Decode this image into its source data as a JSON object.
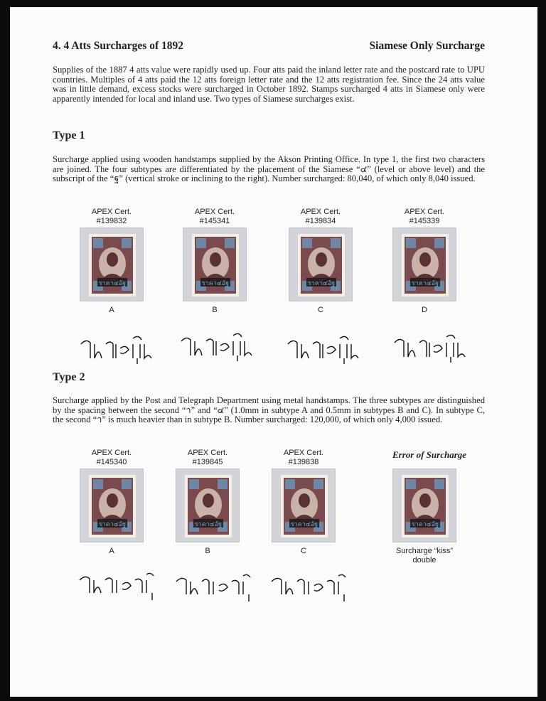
{
  "header": {
    "left": "4.  4 Atts Surcharges of 1892",
    "right": "Siamese Only Surcharge"
  },
  "intro": "Supplies of the 1887 4 atts value were rapidly used up. Four atts paid the inland letter rate and the postcard rate to UPU countries. Multiples of 4 atts paid the 12 atts foreign letter rate and the 12 atts registration fee. Since the 24 atts value was in little demand, excess stocks were surcharged in October 1892. Stamps surcharged 4 atts in Siamese only were apparently intended for local and inland use. Two types of Siamese surcharges exist.",
  "type1": {
    "heading": "Type 1",
    "text": "Surcharge applied using wooden handstamps supplied by the Akson Printing Office. In type 1, the first two characters are joined. The four subtypes are differentiated by the placement of the Siamese “๔” (level or above level) and the subscript of the “ฐ” (vertical stroke or inclining to the right). Number surcharged: 80,040, of which only 8,040 issued.",
    "stamps": [
      {
        "cert": "APEX Cert.",
        "number": "#139832",
        "label": "A",
        "surcharge": "ราคา๔อัฐ"
      },
      {
        "cert": "APEX Cert.",
        "number": "#145341",
        "label": "B",
        "surcharge": "ราคา๔อัฐ"
      },
      {
        "cert": "APEX Cert.",
        "number": "#139834",
        "label": "C",
        "surcharge": "ราคา๔อัฐ"
      },
      {
        "cert": "APEX Cert.",
        "number": "#145339",
        "label": "D",
        "surcharge": "ราคา๔อัฐ"
      }
    ]
  },
  "type2": {
    "heading": "Type 2",
    "text": "Surcharge applied by the Post and Telegraph Department using metal handstamps. The three subtypes are distinguished by the spacing between the second “า” and “๔” (1.0mm in subtype A and 0.5mm in subtypes B and C). In subtype C, the second “า” is much heavier than in subtype B.  Number surcharged: 120,000, of which only 4,000 issued.",
    "stamps": [
      {
        "cert": "APEX Cert.",
        "number": "#145340",
        "label": "A",
        "surcharge": "ราคา๔อัฐ"
      },
      {
        "cert": "APEX Cert.",
        "number": "#139845",
        "label": "B",
        "surcharge": "ราคา๔อัฐ"
      },
      {
        "cert": "APEX Cert.",
        "number": "#139838",
        "label": "C",
        "surcharge": "ราคา๔อัฐ"
      }
    ],
    "error": {
      "title": "Error of Surcharge",
      "caption1": "Surcharge “kiss”",
      "caption2": "double"
    }
  },
  "colors": {
    "frame_bg": "#d3d4da",
    "stamp_paper": "#f4efe4",
    "stamp_brown": "#7a4a4e",
    "stamp_blue": "#6f86a4",
    "ink": "#111111"
  }
}
